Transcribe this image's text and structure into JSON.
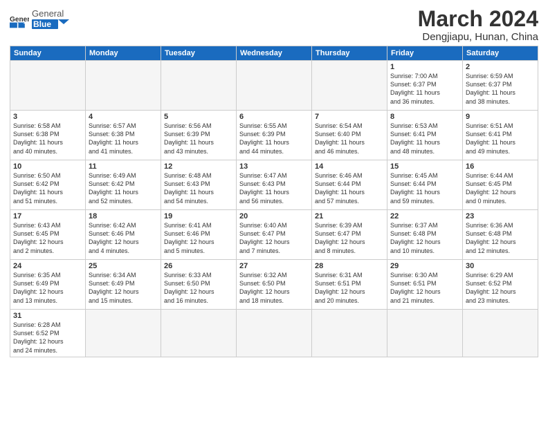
{
  "header": {
    "logo_general": "General",
    "logo_blue": "Blue",
    "month_title": "March 2024",
    "subtitle": "Dengjiapu, Hunan, China"
  },
  "days_of_week": [
    "Sunday",
    "Monday",
    "Tuesday",
    "Wednesday",
    "Thursday",
    "Friday",
    "Saturday"
  ],
  "weeks": [
    [
      {
        "day": "",
        "info": ""
      },
      {
        "day": "",
        "info": ""
      },
      {
        "day": "",
        "info": ""
      },
      {
        "day": "",
        "info": ""
      },
      {
        "day": "",
        "info": ""
      },
      {
        "day": "1",
        "info": "Sunrise: 7:00 AM\nSunset: 6:37 PM\nDaylight: 11 hours\nand 36 minutes."
      },
      {
        "day": "2",
        "info": "Sunrise: 6:59 AM\nSunset: 6:37 PM\nDaylight: 11 hours\nand 38 minutes."
      }
    ],
    [
      {
        "day": "3",
        "info": "Sunrise: 6:58 AM\nSunset: 6:38 PM\nDaylight: 11 hours\nand 40 minutes."
      },
      {
        "day": "4",
        "info": "Sunrise: 6:57 AM\nSunset: 6:38 PM\nDaylight: 11 hours\nand 41 minutes."
      },
      {
        "day": "5",
        "info": "Sunrise: 6:56 AM\nSunset: 6:39 PM\nDaylight: 11 hours\nand 43 minutes."
      },
      {
        "day": "6",
        "info": "Sunrise: 6:55 AM\nSunset: 6:39 PM\nDaylight: 11 hours\nand 44 minutes."
      },
      {
        "day": "7",
        "info": "Sunrise: 6:54 AM\nSunset: 6:40 PM\nDaylight: 11 hours\nand 46 minutes."
      },
      {
        "day": "8",
        "info": "Sunrise: 6:53 AM\nSunset: 6:41 PM\nDaylight: 11 hours\nand 48 minutes."
      },
      {
        "day": "9",
        "info": "Sunrise: 6:51 AM\nSunset: 6:41 PM\nDaylight: 11 hours\nand 49 minutes."
      }
    ],
    [
      {
        "day": "10",
        "info": "Sunrise: 6:50 AM\nSunset: 6:42 PM\nDaylight: 11 hours\nand 51 minutes."
      },
      {
        "day": "11",
        "info": "Sunrise: 6:49 AM\nSunset: 6:42 PM\nDaylight: 11 hours\nand 52 minutes."
      },
      {
        "day": "12",
        "info": "Sunrise: 6:48 AM\nSunset: 6:43 PM\nDaylight: 11 hours\nand 54 minutes."
      },
      {
        "day": "13",
        "info": "Sunrise: 6:47 AM\nSunset: 6:43 PM\nDaylight: 11 hours\nand 56 minutes."
      },
      {
        "day": "14",
        "info": "Sunrise: 6:46 AM\nSunset: 6:44 PM\nDaylight: 11 hours\nand 57 minutes."
      },
      {
        "day": "15",
        "info": "Sunrise: 6:45 AM\nSunset: 6:44 PM\nDaylight: 11 hours\nand 59 minutes."
      },
      {
        "day": "16",
        "info": "Sunrise: 6:44 AM\nSunset: 6:45 PM\nDaylight: 12 hours\nand 0 minutes."
      }
    ],
    [
      {
        "day": "17",
        "info": "Sunrise: 6:43 AM\nSunset: 6:45 PM\nDaylight: 12 hours\nand 2 minutes."
      },
      {
        "day": "18",
        "info": "Sunrise: 6:42 AM\nSunset: 6:46 PM\nDaylight: 12 hours\nand 4 minutes."
      },
      {
        "day": "19",
        "info": "Sunrise: 6:41 AM\nSunset: 6:46 PM\nDaylight: 12 hours\nand 5 minutes."
      },
      {
        "day": "20",
        "info": "Sunrise: 6:40 AM\nSunset: 6:47 PM\nDaylight: 12 hours\nand 7 minutes."
      },
      {
        "day": "21",
        "info": "Sunrise: 6:39 AM\nSunset: 6:47 PM\nDaylight: 12 hours\nand 8 minutes."
      },
      {
        "day": "22",
        "info": "Sunrise: 6:37 AM\nSunset: 6:48 PM\nDaylight: 12 hours\nand 10 minutes."
      },
      {
        "day": "23",
        "info": "Sunrise: 6:36 AM\nSunset: 6:48 PM\nDaylight: 12 hours\nand 12 minutes."
      }
    ],
    [
      {
        "day": "24",
        "info": "Sunrise: 6:35 AM\nSunset: 6:49 PM\nDaylight: 12 hours\nand 13 minutes."
      },
      {
        "day": "25",
        "info": "Sunrise: 6:34 AM\nSunset: 6:49 PM\nDaylight: 12 hours\nand 15 minutes."
      },
      {
        "day": "26",
        "info": "Sunrise: 6:33 AM\nSunset: 6:50 PM\nDaylight: 12 hours\nand 16 minutes."
      },
      {
        "day": "27",
        "info": "Sunrise: 6:32 AM\nSunset: 6:50 PM\nDaylight: 12 hours\nand 18 minutes."
      },
      {
        "day": "28",
        "info": "Sunrise: 6:31 AM\nSunset: 6:51 PM\nDaylight: 12 hours\nand 20 minutes."
      },
      {
        "day": "29",
        "info": "Sunrise: 6:30 AM\nSunset: 6:51 PM\nDaylight: 12 hours\nand 21 minutes."
      },
      {
        "day": "30",
        "info": "Sunrise: 6:29 AM\nSunset: 6:52 PM\nDaylight: 12 hours\nand 23 minutes."
      }
    ],
    [
      {
        "day": "31",
        "info": "Sunrise: 6:28 AM\nSunset: 6:52 PM\nDaylight: 12 hours\nand 24 minutes."
      },
      {
        "day": "",
        "info": ""
      },
      {
        "day": "",
        "info": ""
      },
      {
        "day": "",
        "info": ""
      },
      {
        "day": "",
        "info": ""
      },
      {
        "day": "",
        "info": ""
      },
      {
        "day": "",
        "info": ""
      }
    ]
  ]
}
